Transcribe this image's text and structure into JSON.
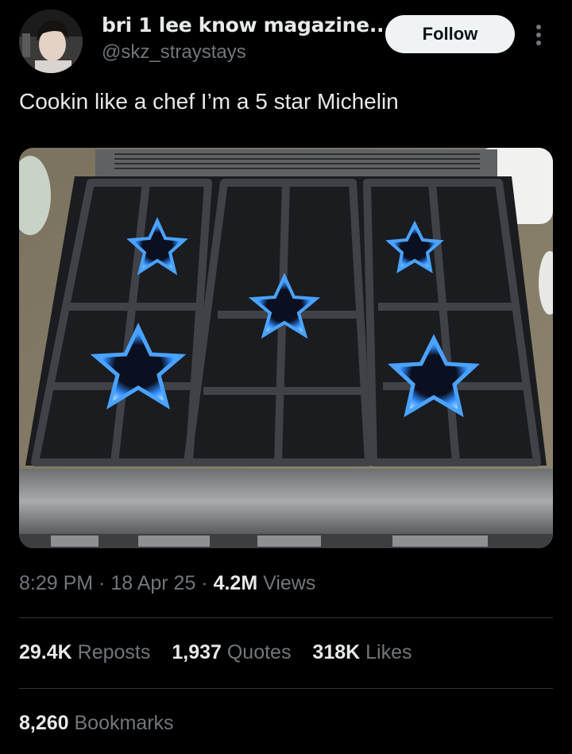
{
  "author": {
    "display_name": "bri 1 lee know magazine...",
    "handle": "@skz_straystays",
    "follow_label": "Follow"
  },
  "tweet": {
    "text": "Cookin like a chef I’m a 5 star Michelin"
  },
  "meta": {
    "time": "8:29 PM",
    "sep1": " · ",
    "date": "18 Apr 25",
    "sep2": " · ",
    "views_count": "4.2M",
    "views_label": " Views"
  },
  "stats": {
    "reposts_count": "29.4K",
    "reposts_label": " Reposts",
    "quotes_count": "1,937",
    "quotes_label": " Quotes",
    "likes_count": "318K",
    "likes_label": " Likes",
    "bookmarks_count": "8,260",
    "bookmarks_label": " Bookmarks"
  },
  "colors": {
    "background": "#000000",
    "text_primary": "#e7e9ea",
    "text_secondary": "#71767b",
    "divider": "#2f3336",
    "follow_bg": "#eff3f4",
    "flame_blue": "#2f8cff"
  },
  "icons": {
    "more": "more-vertical-icon"
  }
}
